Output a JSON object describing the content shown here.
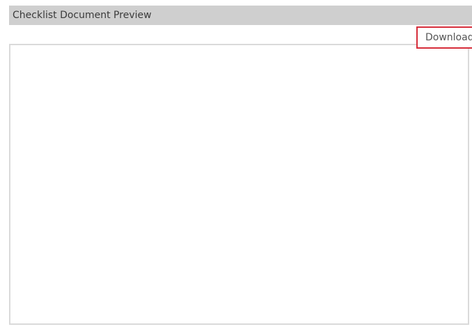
{
  "header": {
    "title": "Checklist Document Preview"
  },
  "toolbar": {
    "download_label": "Download"
  },
  "colors": {
    "header_background": "#cfcfcf",
    "highlight_border": "#d62d3a",
    "frame_border": "#dadada"
  }
}
